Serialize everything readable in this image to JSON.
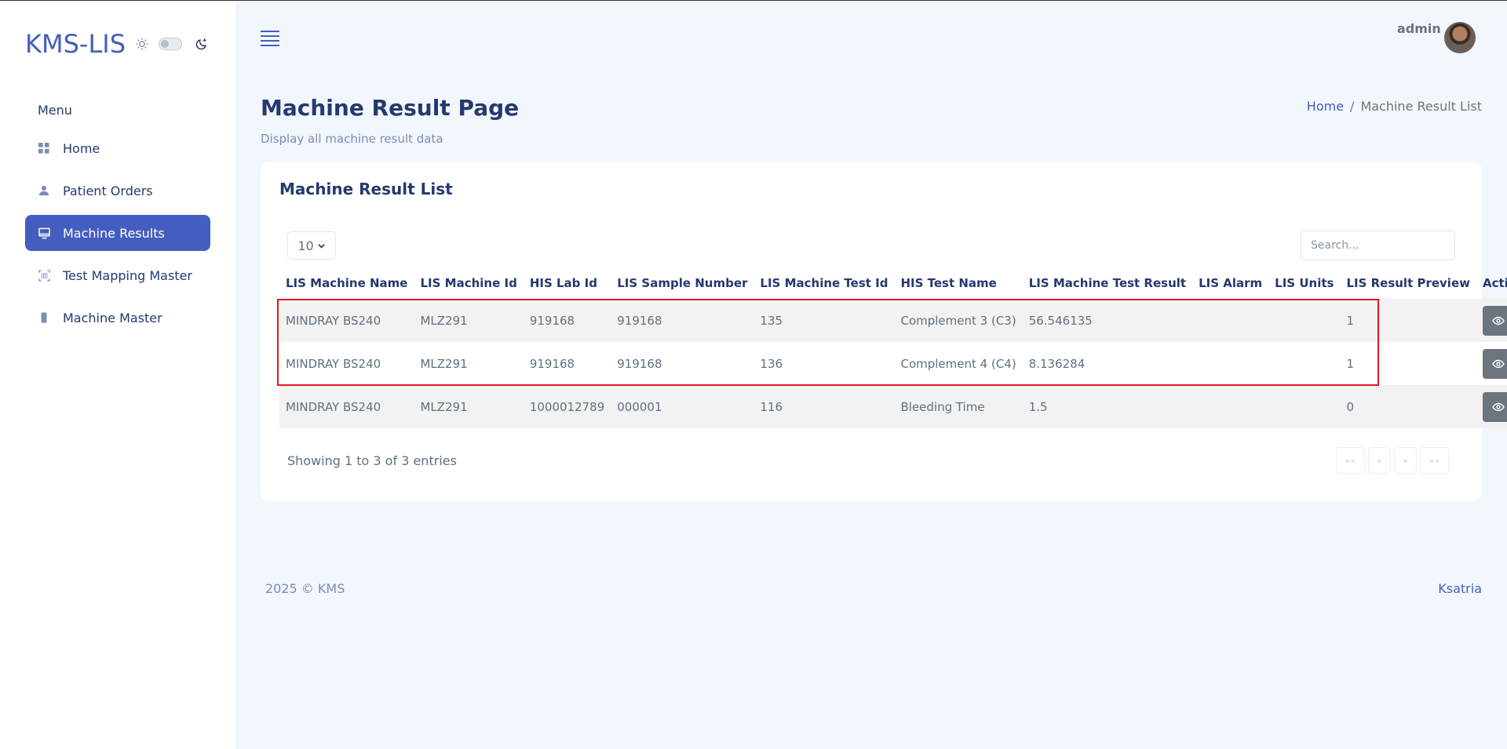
{
  "app": {
    "brand": "KMS-LIS"
  },
  "sidebar": {
    "menu_title": "Menu",
    "items": [
      {
        "label": "Home",
        "icon": "grid-icon",
        "active": false
      },
      {
        "label": "Patient Orders",
        "icon": "person-icon",
        "active": false
      },
      {
        "label": "Machine Results",
        "icon": "monitor-icon",
        "active": true
      },
      {
        "label": "Test Mapping Master",
        "icon": "barcode-scan-icon",
        "active": false
      },
      {
        "label": "Machine Master",
        "icon": "phone-icon",
        "active": false
      }
    ]
  },
  "header": {
    "user": "admin"
  },
  "page": {
    "title": "Machine Result Page",
    "subtitle": "Display all machine result data",
    "breadcrumb": {
      "home": "Home",
      "separator": "/",
      "current": "Machine Result List"
    }
  },
  "card": {
    "title": "Machine Result List",
    "page_length": "10",
    "search_placeholder": "Search...",
    "columns": [
      "LIS Machine Name",
      "LIS Machine Id",
      "HIS Lab Id",
      "LIS Sample Number",
      "LIS Machine Test Id",
      "HIS Test Name",
      "LIS Machine Test Result",
      "LIS Alarm",
      "LIS Units",
      "LIS Result Preview",
      "Action"
    ],
    "rows": [
      [
        "MINDRAY BS240",
        "MLZ291",
        "919168",
        "919168",
        "135",
        "Complement 3 (C3)",
        "56.546135",
        "",
        "",
        "1"
      ],
      [
        "MINDRAY BS240",
        "MLZ291",
        "919168",
        "919168",
        "136",
        "Complement 4 (C4)",
        "8.136284",
        "",
        "",
        "1"
      ],
      [
        "MINDRAY BS240",
        "MLZ291",
        "1000012789",
        "000001",
        "116",
        "Bleeding Time",
        "1.5",
        "",
        "",
        "0"
      ]
    ],
    "info": "Showing 1 to 3 of 3 entries",
    "pagination": [
      "««",
      "«",
      "»",
      "»»"
    ]
  },
  "footer": {
    "left": "2025 © KMS",
    "right": "Ksatria"
  },
  "colors": {
    "primary": "#435ebe",
    "highlight": "#e0191f",
    "action_button": "#6c757d"
  }
}
